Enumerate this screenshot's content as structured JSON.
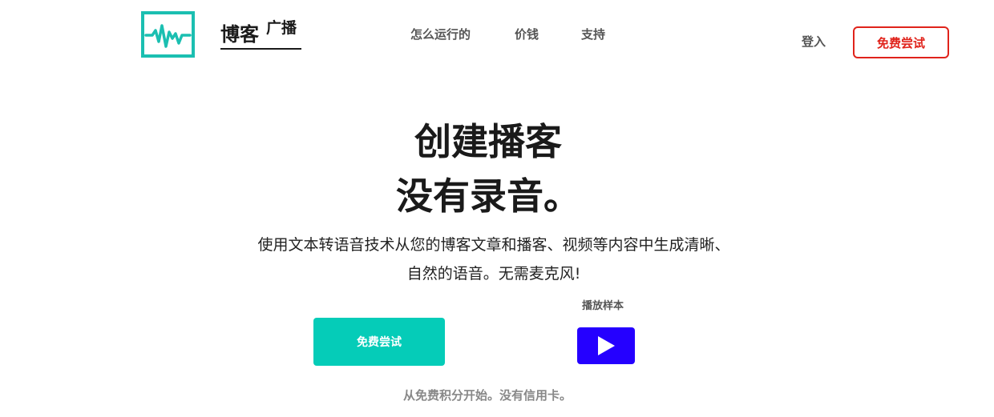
{
  "colors": {
    "brand_teal": "#1bbfb1",
    "primary_cta": "#05ccb8",
    "play_button": "#2500ff",
    "header_cta_border": "#e0231b"
  },
  "header": {
    "logo_icon": "waveform-logo-icon",
    "logo_text_main": "博客",
    "logo_text_sup": "广播",
    "nav": [
      {
        "label": "怎么运行的"
      },
      {
        "label": "价钱"
      },
      {
        "label": "支持"
      }
    ],
    "login_label": "登入",
    "cta_label": "免费尝试"
  },
  "hero": {
    "headline_line1": "创建播客",
    "headline_line2": "没有录音。",
    "subtitle": "使用文本转语音技术从您的博客文章和播客、视频等内容中生成清晰、自然的语音。无需麦克风!",
    "primary_cta_label": "免费尝试",
    "sample_label": "播放样本",
    "play_icon": "play-icon",
    "footnote": "从免费积分开始。没有信用卡。"
  }
}
